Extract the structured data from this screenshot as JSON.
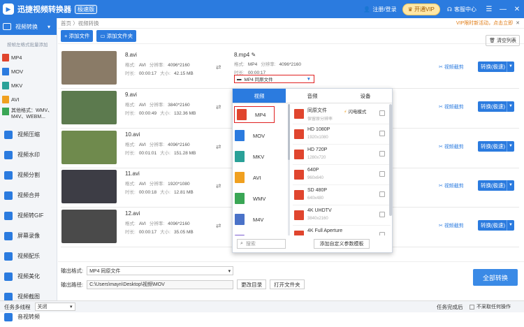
{
  "app": {
    "title": "迅捷视频转换器",
    "badge": "极速版",
    "login": "注册/登录",
    "vip": "开通VIP",
    "service": "客服中心"
  },
  "sidebar": {
    "top_item": "视频转换",
    "note": "按帧左格式批量添加",
    "formats": [
      "MP4",
      "MOV",
      "MKV",
      "AVI"
    ],
    "other_formats": "其他格式：WMV、M4V、WEBM...",
    "items": [
      "视频压缩",
      "视频水印",
      "视频分割",
      "视频合并",
      "视频转GIF",
      "屏幕录像",
      "视频配乐",
      "视频美化",
      "视频截图",
      "音视转频"
    ]
  },
  "breadcrumb": "首页 〉视频转换",
  "notice": "VIP限时新活动，点击立即",
  "toolbar": {
    "add_file": "添加文件",
    "add_folder": "添加文件夹",
    "clear": "清空列表"
  },
  "labels": {
    "format": "格式:",
    "resolution": "分辨率:",
    "duration": "时长:",
    "size": "大小:",
    "trim": "视频截剪",
    "convert": "转换(极速)"
  },
  "files": [
    {
      "name": "8.avi",
      "format": "AVI",
      "resolution": "4096*2160",
      "duration": "00:00:17",
      "size": "42.15 MB",
      "thumb": "#8a7b67"
    },
    {
      "name": "9.avi",
      "format": "AVI",
      "resolution": "3840*2160",
      "duration": "00:00:49",
      "size": "132.36 MB",
      "thumb": "#5c7a4e"
    },
    {
      "name": "10.avi",
      "format": "AVI",
      "resolution": "4096*2160",
      "duration": "00:01:01",
      "size": "151.28 MB",
      "thumb": "#6f8a4d"
    },
    {
      "name": "11.avi",
      "format": "AVI",
      "resolution": "1920*1080",
      "duration": "00:00:18",
      "size": "12.81 MB",
      "thumb": "#3d3d45"
    },
    {
      "name": "12.avi",
      "format": "AVI",
      "resolution": "4096*2160",
      "duration": "00:00:17",
      "size": "35.05 MB",
      "thumb": "#4a4a4a"
    }
  ],
  "output_preview": {
    "name": "8.mp4",
    "format": "MP4",
    "resolution": "4096*2160",
    "duration": "00:00:17",
    "fmt_select": "MP4  同原文件"
  },
  "popup": {
    "tabs": [
      "视频",
      "音频",
      "设备"
    ],
    "formats": [
      "MP4",
      "MOV",
      "MKV",
      "AVI",
      "WMV",
      "M4V",
      "MPG"
    ],
    "presets": [
      {
        "title": "同原文件",
        "sub": "保留原分辨率",
        "flash": "闪电模式"
      },
      {
        "title": "HD 1080P",
        "sub": "1920x1080"
      },
      {
        "title": "HD 720P",
        "sub": "1280x720"
      },
      {
        "title": "640P",
        "sub": "960x640"
      },
      {
        "title": "SD 480P",
        "sub": "640x480"
      },
      {
        "title": "4K UHDTV",
        "sub": "3840x2160"
      },
      {
        "title": "4K Full Aperture",
        "sub": ""
      }
    ],
    "search": "搜索",
    "custom": "添加自定义参数模板"
  },
  "bottom": {
    "out_format_label": "输出格式:",
    "out_format": "MP4  同原文件",
    "out_path_label": "输出路径:",
    "out_path": "C:\\Users\\mayn\\Desktop\\视频\\MOV",
    "change_dir": "更改目录",
    "open_folder": "打开文件夹",
    "convert_all": "全部转换"
  },
  "status": {
    "multi_thread": "任务多线程",
    "mode": "关闭",
    "done_label": "任务完成后",
    "no_op": "不采取任何操作"
  },
  "colors": {
    "primary": "#2b7bdf",
    "highlight_border": "#e02020"
  }
}
